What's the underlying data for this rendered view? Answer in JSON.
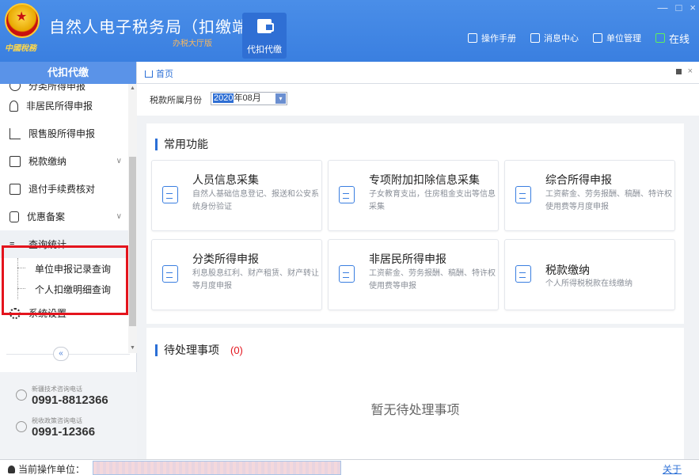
{
  "app": {
    "logo_text": "中國稅務",
    "title": "自然人电子税务局（扣缴端）",
    "subtitle": "办税大厅版",
    "main_tab": "代扣代缴",
    "links": [
      "操作手册",
      "消息中心",
      "单位管理"
    ],
    "online": "在线",
    "window_controls": [
      "—",
      "□",
      "×"
    ]
  },
  "sidebar": {
    "header": "代扣代缴",
    "items": [
      {
        "label": "分类所得申报",
        "icon": "refresh-icon",
        "partial": true
      },
      {
        "label": "非居民所得申报",
        "icon": "person-icon"
      },
      {
        "label": "限售股所得申报",
        "icon": "bar-chart-icon"
      },
      {
        "label": "税款缴纳",
        "icon": "tax-payment-icon",
        "expandable": true
      },
      {
        "label": "退付手续费核对",
        "icon": "document-icon"
      },
      {
        "label": "优惠备案",
        "icon": "file-icon",
        "expandable": true
      },
      {
        "label": "查询统计",
        "icon": "query-icon",
        "expanded": true,
        "children": [
          "单位申报记录查询",
          "个人扣缴明细查询"
        ]
      },
      {
        "label": "系统设置",
        "icon": "gear-icon"
      }
    ],
    "collapse_glyph": "«",
    "hotlines": [
      {
        "label": "新疆技术咨询电话",
        "number": "0991-8812366"
      },
      {
        "label": "税收政策咨询电话",
        "number": "0991-12366"
      }
    ]
  },
  "tabbar": {
    "home": "首页",
    "close": "×"
  },
  "filter": {
    "label": "税款所属月份",
    "year": "2020",
    "month_suffix": "年08月",
    "dropdown": "▾"
  },
  "common": {
    "title": "常用功能",
    "cards": [
      {
        "title": "人员信息采集",
        "desc": "自然人基础信息登记、报送和公安系统身份验证",
        "icon": "id-card-icon"
      },
      {
        "title": "专项附加扣除信息采集",
        "desc": "子女教育支出，住房租金支出等信息采集",
        "icon": "calendar-icon"
      },
      {
        "title": "综合所得申报",
        "desc": "工资薪金、劳务报酬、稿酬、特许权使用费等月度申报",
        "icon": "report-icon"
      },
      {
        "title": "分类所得申报",
        "desc": "利息股息红利、财产租赁、财产转让等月度申报",
        "icon": "edit-icon"
      },
      {
        "title": "非居民所得申报",
        "desc": "工资薪金、劳务报酬、稿酬、特许权使用费等申报",
        "icon": "edit-icon"
      },
      {
        "title": "税款缴纳",
        "desc": "个人所得税税款在线缴纳",
        "icon": "payment-icon"
      }
    ]
  },
  "pending": {
    "title": "待处理事项",
    "count": "(0)",
    "empty": "暂无待处理事项"
  },
  "status": {
    "unit_label": "当前操作单位：",
    "about": "关于"
  }
}
